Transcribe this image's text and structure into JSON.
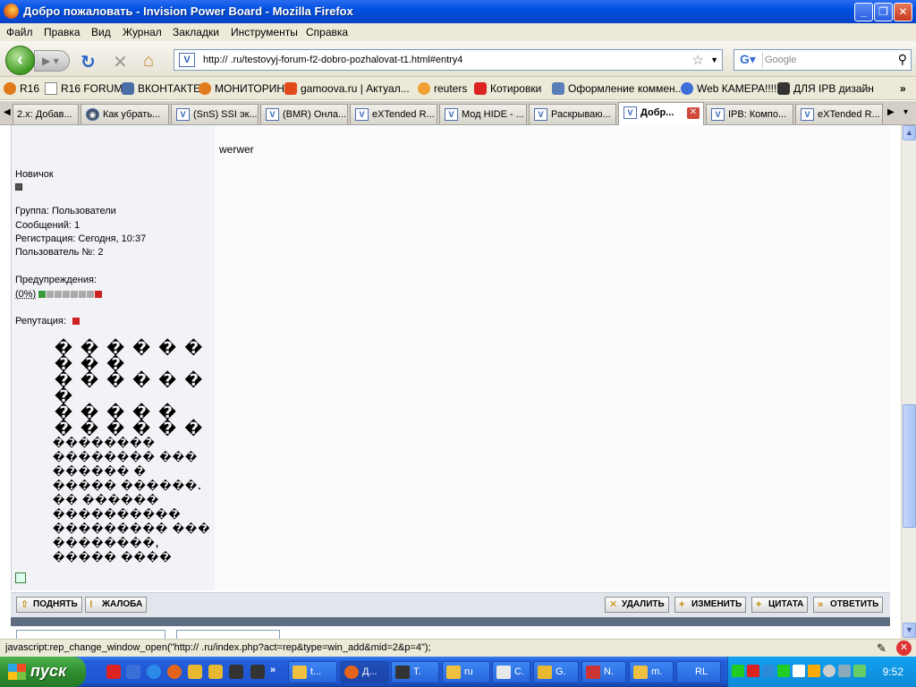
{
  "window": {
    "title": "Добро пожаловать - Invision Power Board - Mozilla Firefox"
  },
  "menu": [
    "Файл",
    "Правка",
    "Вид",
    "Журнал",
    "Закладки",
    "Инструменты",
    "Справка"
  ],
  "nav": {
    "url": "http://        .ru/testovyj-forum-f2-dobro-pozhalovat-t1.html#entry4",
    "search_placeholder": "Google"
  },
  "bookmarks": [
    "R16",
    "R16 FORUM",
    "ВКОНТАКТЕ",
    "МОНИТОРИНГ",
    "gamoova.ru | Актуал...",
    "reuters",
    "Котировки",
    "Оформление коммен...",
    "Web КАМЕРА!!!!",
    "ДЛЯ IPB дизайн"
  ],
  "tabs": [
    "2.x: Добав...",
    "Как убрать...",
    "(SnS) SSI эк...",
    "(BMR) Онла...",
    "eXTended R...",
    "Мод HIDE - ...",
    "Раскрываю...",
    "Добр...",
    "IPB: Компо...",
    "eXTended R..."
  ],
  "user": {
    "rank": "Новичок",
    "group": "Группа: Пользователи",
    "posts": "Сообщений: 1",
    "registered": "Регистрация: Сегодня, 10:37",
    "member_no": "Пользователь №: 2",
    "warnings_label": "Предупреждения:",
    "warnings_value": "(0%)",
    "reputation_label": "Репутация:"
  },
  "post": {
    "body": "werwer"
  },
  "garbled": {
    "big": [
      "� � � � � �",
      "� � �",
      "� � � � � �",
      "�",
      "� � � � �",
      "� � � � � �"
    ],
    "small": [
      "��������",
      "�������� ���",
      "������ �",
      "����� ������.",
      "�� ������",
      "����������",
      "��������� ���",
      "��������,",
      "����� ����"
    ]
  },
  "post_buttons": {
    "top": "ПОДНЯТЬ",
    "complain": "ЖАЛОБА",
    "delete": "УДАЛИТЬ",
    "edit": "ИЗМЕНИТЬ",
    "quote": "ЦИТАТА",
    "reply": "ОТВЕТИТЬ"
  },
  "status": {
    "text": "javascript:rep_change_window_open(\"http://        .ru/index.php?act=rep&type=win_add&mid=2&p=4\");"
  },
  "taskbar": {
    "start": "пуск",
    "buttons": [
      "t...",
      "Д...",
      "T.",
      "ru",
      "C.",
      "G.",
      "N.",
      "m.",
      "RL"
    ],
    "clock": "9:52"
  }
}
